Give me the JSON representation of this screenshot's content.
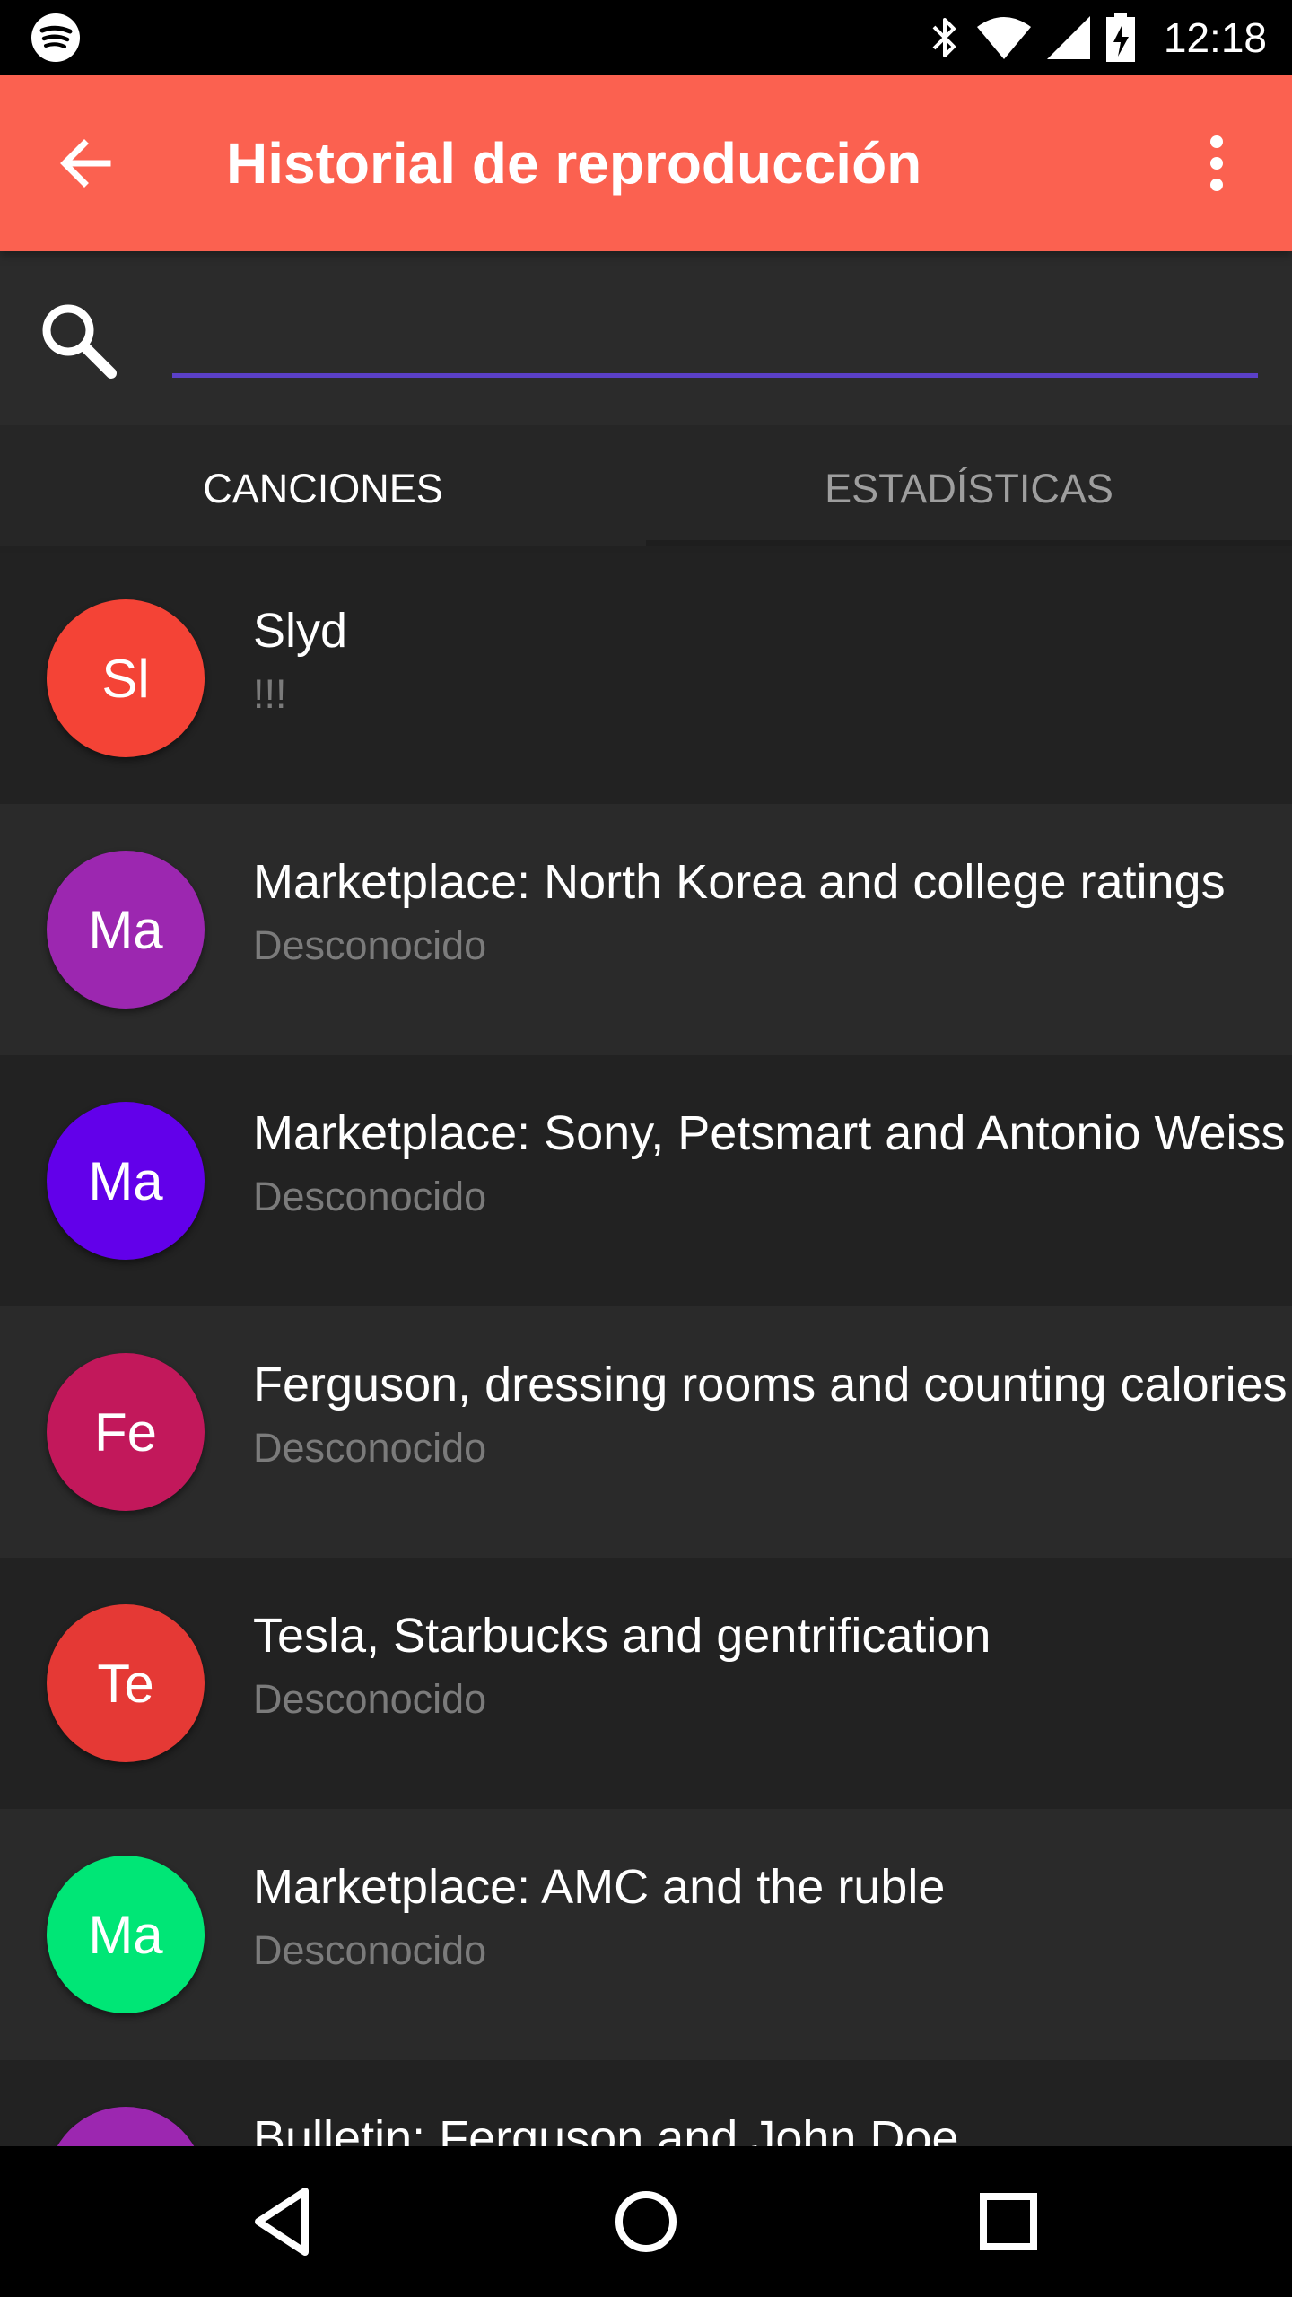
{
  "status_bar": {
    "time": "12:18",
    "icons": [
      "spotify-icon",
      "bluetooth-icon",
      "wifi-icon",
      "signal-icon",
      "battery-charging-icon"
    ]
  },
  "app_bar": {
    "title": "Historial de reproducción",
    "back_icon": "arrow-back-icon",
    "menu_icon": "more-vert-icon",
    "color": "#fb6150"
  },
  "search": {
    "value": "",
    "placeholder": "",
    "underline_color": "#5b40c7"
  },
  "tabs": [
    {
      "label": "CANCIONES",
      "selected": true
    },
    {
      "label": "ESTADÍSTICAS",
      "selected": false
    }
  ],
  "list": [
    {
      "initials": "Sl",
      "title": "Slyd",
      "subtitle": "!!!",
      "color": "#f44336"
    },
    {
      "initials": "Ma",
      "title": "Marketplace: North Korea and college ratings",
      "subtitle": "Desconocido",
      "color": "#9c27b0"
    },
    {
      "initials": "Ma",
      "title": "Marketplace: Sony, Petsmart and Antonio Weiss",
      "subtitle": "Desconocido",
      "color": "#6200ea"
    },
    {
      "initials": "Fe",
      "title": "Ferguson, dressing rooms and counting calories",
      "subtitle": "Desconocido",
      "color": "#c2185b"
    },
    {
      "initials": "Te",
      "title": "Tesla, Starbucks and gentrification",
      "subtitle": "Desconocido",
      "color": "#e53935"
    },
    {
      "initials": "Ma",
      "title": "Marketplace: AMC and the ruble",
      "subtitle": "Desconocido",
      "color": "#00e676"
    },
    {
      "initials": "",
      "title": "Bulletin: Ferguson and John Doe",
      "subtitle": "",
      "color": "#9c27b0"
    }
  ],
  "nav_bar": {
    "icons": [
      "back-triangle-icon",
      "home-circle-icon",
      "recents-square-icon"
    ]
  }
}
